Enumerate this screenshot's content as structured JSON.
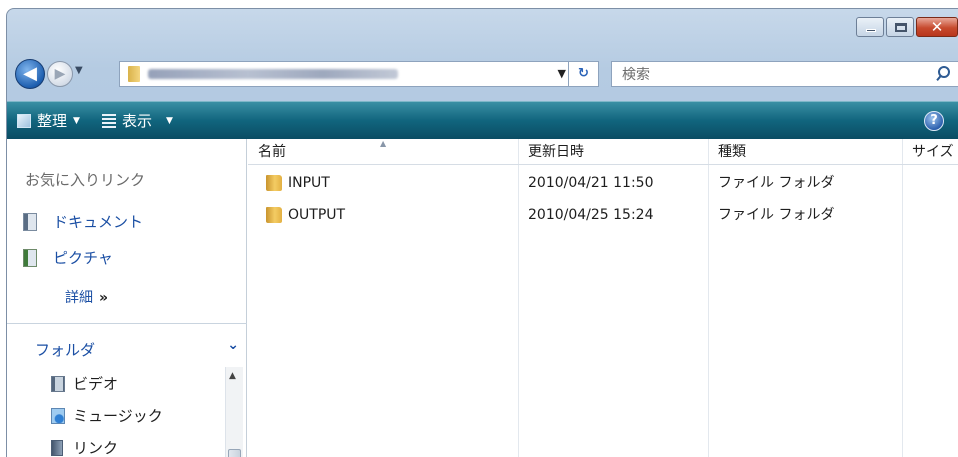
{
  "window": {
    "caption": {
      "close_glyph": "✕"
    }
  },
  "address": {
    "back_glyph": "◀",
    "forward_glyph": "▶",
    "dropdown_glyph": "▼",
    "refresh_glyph": "↻"
  },
  "search": {
    "placeholder": "検索"
  },
  "toolbar": {
    "organize_label": "整理",
    "views_label": "表示",
    "caret": "▼",
    "help_glyph": "?"
  },
  "nav": {
    "favorites_title": "お気に入りリンク",
    "favorites": [
      {
        "label": "ドキュメント",
        "icon": "documents-icon"
      },
      {
        "label": "ピクチャ",
        "icon": "pictures-icon"
      }
    ],
    "details_label": "詳細",
    "details_chevron": "»",
    "folders_label": "フォルダ",
    "folders_chevron": "⌄",
    "tree": [
      {
        "label": "ビデオ",
        "icon": "video-icon"
      },
      {
        "label": "ミュージック",
        "icon": "music-icon"
      },
      {
        "label": "リンク",
        "icon": "links-icon"
      }
    ]
  },
  "list": {
    "columns": [
      "名前",
      "更新日時",
      "種類",
      "サイズ"
    ],
    "rows": [
      {
        "name": "INPUT",
        "date": "2010/04/21 11:50",
        "type": "ファイル フォルダ"
      },
      {
        "name": "OUTPUT",
        "date": "2010/04/25 15:24",
        "type": "ファイル フォルダ"
      }
    ]
  },
  "colors": {
    "command_bar": "#11657e",
    "link_blue": "#1b4fa4",
    "close_red": "#c74a2e"
  }
}
